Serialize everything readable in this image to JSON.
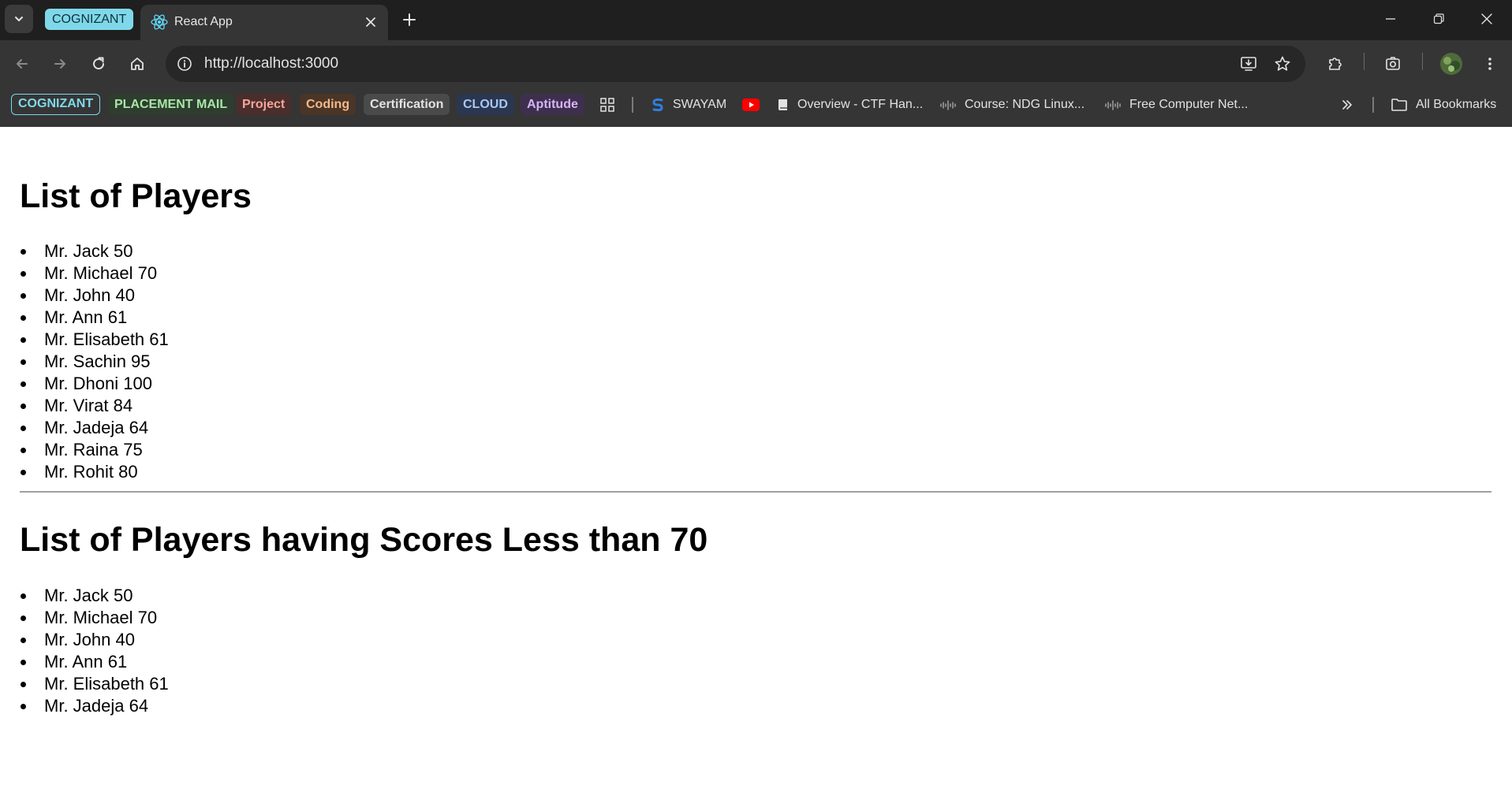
{
  "browser": {
    "tab_group_label": "COGNIZANT",
    "active_tab_title": "React App",
    "url": "http://localhost:3000"
  },
  "bookmarks": {
    "chips": [
      {
        "label": "COGNIZANT",
        "color": "#7fd8ea"
      },
      {
        "label": "PLACEMENT MAIL",
        "color": "#a8e6a8"
      },
      {
        "label": "Project",
        "color": "#f6a59b"
      },
      {
        "label": "Coding",
        "color": "#f5b88a"
      },
      {
        "label": "Certification",
        "color": "#d9d9d9"
      },
      {
        "label": "CLOUD",
        "color": "#a9c7f5"
      },
      {
        "label": "Aptitude",
        "color": "#d8b4f5"
      }
    ],
    "items": [
      {
        "label": "SWAYAM",
        "icon": "swayam-icon"
      },
      {
        "label": "",
        "icon": "youtube-icon"
      },
      {
        "label": "Overview - CTF Han...",
        "icon": "book-icon"
      },
      {
        "label": "Course: NDG Linux...",
        "icon": "cisco-icon"
      },
      {
        "label": "Free Computer Net...",
        "icon": "cisco-icon"
      }
    ],
    "all_bookmarks_label": "All Bookmarks"
  },
  "page": {
    "heading_all": "List of Players",
    "players_all": [
      "Mr. Jack 50",
      "Mr. Michael 70",
      "Mr. John 40",
      "Mr. Ann 61",
      "Mr. Elisabeth 61",
      "Mr. Sachin 95",
      "Mr. Dhoni 100",
      "Mr. Virat 84",
      "Mr. Jadeja 64",
      "Mr. Raina 75",
      "Mr. Rohit 80"
    ],
    "heading_filtered": "List of Players having Scores Less than 70",
    "players_filtered": [
      "Mr. Jack 50",
      "Mr. Michael 70",
      "Mr. John 40",
      "Mr. Ann 61",
      "Mr. Elisabeth 61",
      "Mr. Jadeja 64"
    ]
  }
}
